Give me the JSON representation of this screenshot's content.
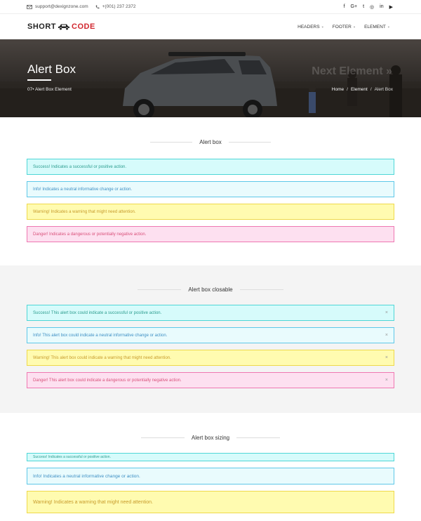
{
  "topbar": {
    "email": "support@dexignzone.com",
    "phone": "+(001) 237 2372",
    "social": [
      "f",
      "G+",
      "t",
      "◎",
      "in",
      "▶"
    ]
  },
  "nav": {
    "logo_left": "SHORT",
    "logo_right": "CODE",
    "menu": [
      "HEADERS",
      "FOOTER",
      "ELEMENT"
    ]
  },
  "hero": {
    "title": "Alert Box",
    "subtitle": "07• Alert Box Element",
    "next": "Next Element »",
    "breadcrumb": [
      "Home",
      "Element",
      "Alert Box"
    ]
  },
  "sections": [
    {
      "heading": "Alert box",
      "alerts": [
        {
          "type": "success",
          "text": "Success! Indicates a successful or positive action."
        },
        {
          "type": "info",
          "text": "Info! Indicates a neutral informative change or action."
        },
        {
          "type": "warning",
          "text": "Warning! Indicates a warning that might need attention."
        },
        {
          "type": "danger",
          "text": "Danger! Indicates a dangerous or potentially negative action."
        }
      ]
    },
    {
      "heading": "Alert box closable",
      "close": "×",
      "alerts": [
        {
          "type": "success",
          "text": "Success! This alert box could indicate a successful or positive action."
        },
        {
          "type": "info",
          "text": "Info! This alert box could indicate a neutral informative change or action."
        },
        {
          "type": "warning",
          "text": "Warning! This alert box could indicate a warning that might need attention."
        },
        {
          "type": "danger",
          "text": "Danger! This alert box could indicate a dangerous or potentially negative action."
        }
      ]
    },
    {
      "heading": "Alert box sizing",
      "alerts": [
        {
          "type": "success",
          "text": "Success! Indicates a successful or positive action."
        },
        {
          "type": "info",
          "text": "Info! Indicates a neutral informative change or action."
        },
        {
          "type": "warning",
          "text": "Warning! Indicates a warning that might need attention."
        }
      ]
    }
  ]
}
